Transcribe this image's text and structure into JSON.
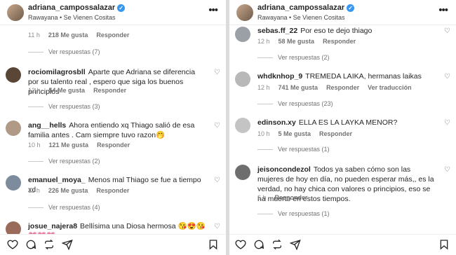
{
  "left": {
    "username": "adriana_campossalazar",
    "subtitle": "Rawayana • Se Vienen Cositas",
    "top": {
      "time": "11 h",
      "likes": "218 Me gusta",
      "reply": "Responder",
      "view_replies": "Ver respuestas (7)"
    },
    "comments": [
      {
        "user": "rociomilagrosbll",
        "text": "Aparte que Adriana se diferencia por su talento real , espero que siga los buenos principios",
        "time": "12 h",
        "likes": "54 Me gusta",
        "reply": "Responder",
        "view_replies": "Ver respuestas (3)",
        "color": "#5a4636"
      },
      {
        "user": "ang__hells",
        "text": "Ahora entiendo xq Thiago salió de esa familia antes . Cam siempre tuvo razon🤭",
        "time": "10 h",
        "likes": "121 Me gusta",
        "reply": "Responder",
        "view_replies": "Ver respuestas (2)",
        "color": "#b09a86"
      },
      {
        "user": "emanuel_moya_",
        "text": "Menos mal Thiago se fue a tiempo xd",
        "time": "11 h",
        "likes": "226 Me gusta",
        "reply": "Responder",
        "view_replies": "Ver respuestas (4)",
        "color": "#7c8c9c"
      },
      {
        "user": "josue_najera8",
        "text": "Bellísima una Diosa hermosa 😘😍😘💗💗💗",
        "color": "#9a6a5a"
      }
    ]
  },
  "right": {
    "username": "adriana_campossalazar",
    "subtitle": "Rawayana • Se Vienen Cositas",
    "comments": [
      {
        "user": "sebas.ff_22",
        "text": "Por eso te dejo thiago",
        "time": "12 h",
        "likes": "58 Me gusta",
        "reply": "Responder",
        "view_replies": "Ver respuestas (2)",
        "color": "#9aa0a6"
      },
      {
        "user": "whdknhop_9",
        "text": "TREMEDA LAIKA, hermanas laikas",
        "time": "12 h",
        "likes": "741 Me gusta",
        "reply": "Responder",
        "translate": "Ver traducción",
        "view_replies": "Ver respuestas (23)",
        "color": "#b8b8b8"
      },
      {
        "user": "edinson.xy",
        "text": "ELLA ES LA LAYKA MENOR?",
        "time": "10 h",
        "likes": "5 Me gusta",
        "reply": "Responder",
        "view_replies": "Ver respuestas (1)",
        "color": "#c4c4c4"
      },
      {
        "user": "jeisoncondezol",
        "text": "Todos ya saben cómo son las mujeres de hoy en día, no pueden esperar más,, es la verdad, no hay chica con valores o principios, eso se ha muerto en estos tiempos.",
        "time": "6 h",
        "reply": "Responder",
        "view_replies": "Ver respuestas (1)",
        "color": "#6e6e6e"
      }
    ]
  },
  "icons": [
    "heart-icon",
    "comment-icon",
    "repost-icon",
    "share-icon",
    "bookmark-icon"
  ]
}
